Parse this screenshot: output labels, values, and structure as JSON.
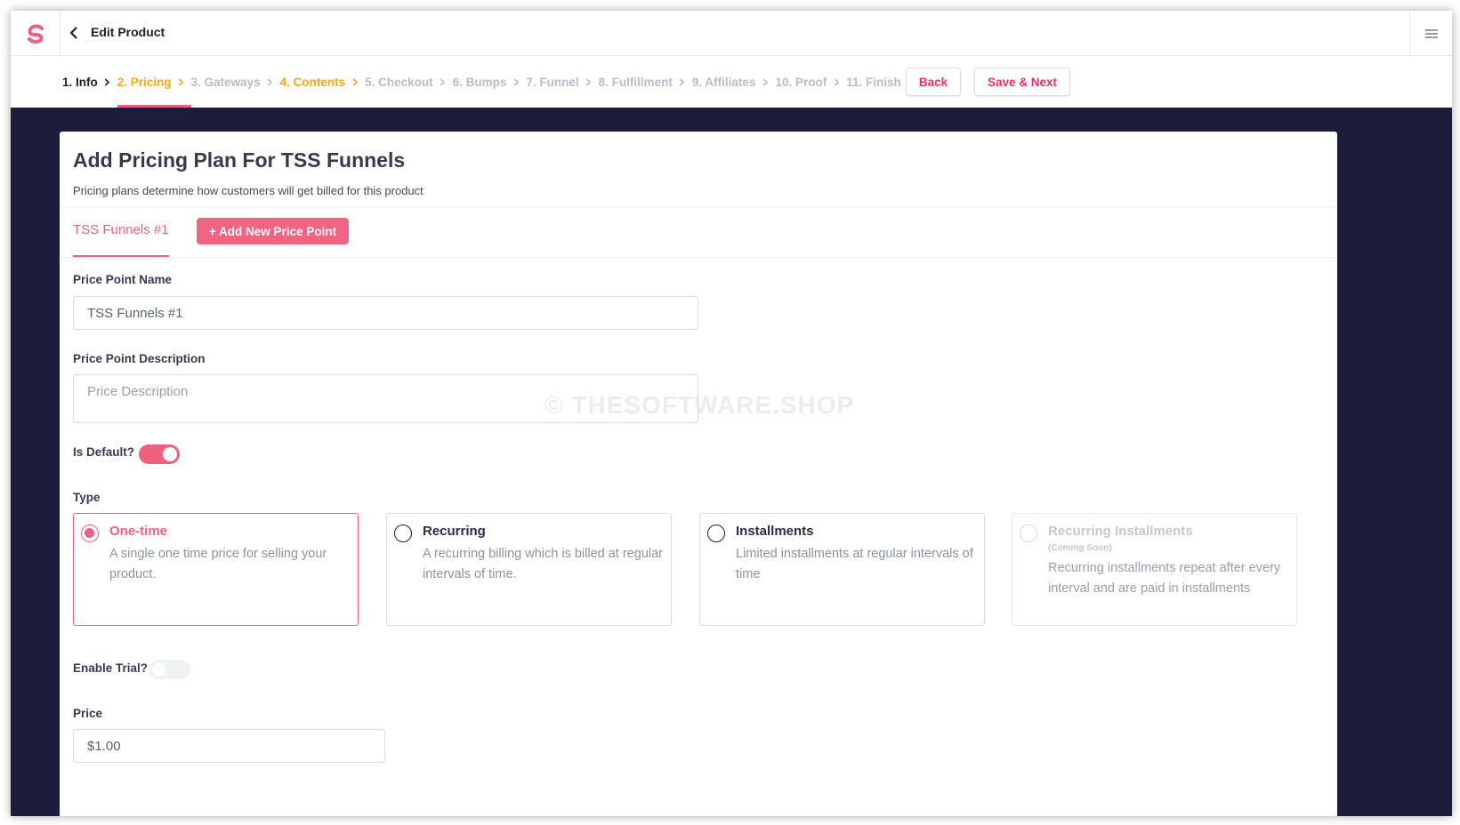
{
  "header": {
    "title": "Edit Product",
    "brand_color": "#f0607e"
  },
  "steps": [
    {
      "label": "1. Info",
      "state": "done"
    },
    {
      "label": "2. Pricing",
      "state": "current"
    },
    {
      "label": "3. Gateways",
      "state": "todo"
    },
    {
      "label": "4. Contents",
      "state": "orange"
    },
    {
      "label": "5. Checkout",
      "state": "todo"
    },
    {
      "label": "6. Bumps",
      "state": "todo"
    },
    {
      "label": "7. Funnel",
      "state": "todo"
    },
    {
      "label": "8. Fulfillment",
      "state": "todo"
    },
    {
      "label": "9. Affiliates",
      "state": "todo"
    },
    {
      "label": "10. Proof",
      "state": "todo"
    },
    {
      "label": "11. Finish",
      "state": "todo"
    }
  ],
  "actions": {
    "back_label": "Back",
    "save_label": "Save & Next"
  },
  "card": {
    "title": "Add Pricing Plan For TSS Funnels",
    "subtitle": "Pricing plans determine how customers will get billed for this product",
    "tab_label": "TSS Funnels #1",
    "add_button_label": "+ Add New Price Point"
  },
  "form": {
    "name_label": "Price Point Name",
    "name_value": "TSS Funnels #1",
    "description_label": "Price Point Description",
    "description_placeholder": "Price Description",
    "default_label": "Is Default?",
    "default_on": true,
    "type_label": "Type",
    "types": [
      {
        "title": "One-time",
        "note": "",
        "description": "A single one time price for selling your product.",
        "selected": true,
        "disabled": false
      },
      {
        "title": "Recurring",
        "note": "",
        "description": "A recurring billing which is billed at regular intervals of time.",
        "selected": false,
        "disabled": false
      },
      {
        "title": "Installments",
        "note": "",
        "description": "Limited installments at regular intervals of time",
        "selected": false,
        "disabled": false
      },
      {
        "title": "Recurring Installments",
        "note": "(Coming Soon)",
        "description": "Recurring installments repeat after every interval and are paid in installments",
        "selected": false,
        "disabled": true
      }
    ],
    "trial_label": "Enable Trial?",
    "trial_on": false,
    "price_label": "Price",
    "price_value": "$1.00"
  },
  "watermark": "© THESOFTWARE.SHOP"
}
